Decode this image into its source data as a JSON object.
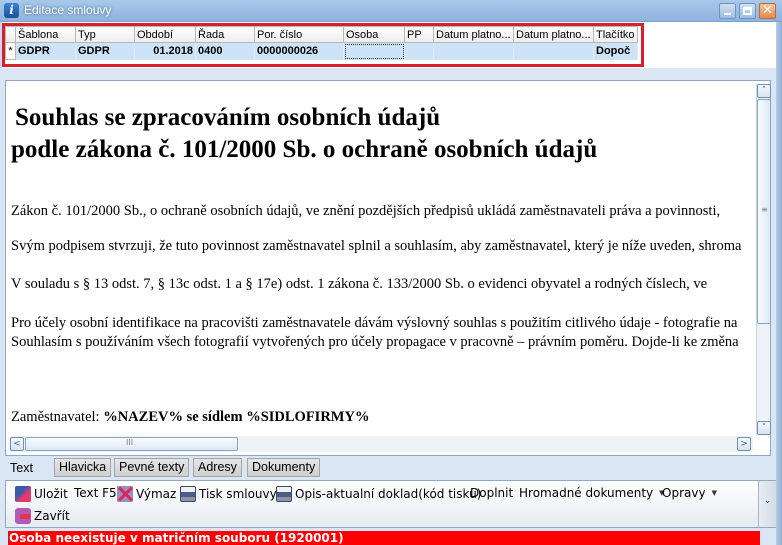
{
  "window": {
    "title": "Editace smlouvy",
    "icon": "info-icon",
    "controls": {
      "minimize": "minimize-icon",
      "maximize": "maximize-icon",
      "close": "close-icon"
    }
  },
  "grid": {
    "columns": [
      "Šablona",
      "Typ",
      "Období",
      "Řada",
      "Por. číslo",
      "Osoba",
      "PP",
      "Datum platno...",
      "Datum platno...",
      "Tlačítko"
    ],
    "row_indicator": "*",
    "rows": [
      [
        "GDPR",
        "GDPR",
        "01.2018",
        "0400",
        "0000000026",
        "",
        "",
        "",
        "",
        "Dopoč"
      ]
    ]
  },
  "document": {
    "heading_line1": "Souhlas se zpracováním osobních údajů",
    "heading_line2": "podle zákona č. 101/2000 Sb. o ochraně osobních údajů",
    "paragraphs": [
      "Zákon č. 101/2000 Sb., o ochraně osobních údajů, ve znění pozdějších předpisů ukládá zaměstnavateli práva a povinnosti,",
      "Svým podpisem stvrzuji, že tuto povinnost zaměstnavatel splnil a souhlasím, aby zaměstnavatel, který je níže uveden, shroma",
      "V souladu s § 13 odst. 7, § 13c odst. 1 a § 17e) odst. 1 zákona č. 133/2000 Sb. o evidenci obyvatel a rodných číslech, ve",
      "Pro účely osobní identifikace na pracovišti zaměstnavatele dávám výslovný souhlas s použitím citlivého údaje - fotografie na",
      "Souhlasím s používáním všech fotografií vytvořených pro účely propagace v pracovně – právním poměru. Dojde-li ke změna"
    ],
    "employer_label": "Zaměstnavatel: ",
    "employer_value": "%NAZEV% se sídlem %SIDLOFIRMY%"
  },
  "tabs": [
    {
      "label": "Text",
      "active": true
    },
    {
      "label": "Hlavicka",
      "active": false
    },
    {
      "label": "Pevné texty",
      "active": false
    },
    {
      "label": "Adresy",
      "active": false
    },
    {
      "label": "Dokumenty",
      "active": false
    }
  ],
  "toolbar": {
    "save": "Uložit",
    "text_f5": "Text F5",
    "delete": "Výmaz",
    "print_contract": "Tisk smlouvy",
    "print_copy": "Opis-aktualní doklad(kód tisku)",
    "fill": "Doplnit",
    "bulk_documents": "Hromadné dokumenty",
    "corrections": "Opravy",
    "close": "Zavřít",
    "dropdown_caret": "▼",
    "overflow": "⌄"
  },
  "status": {
    "message": "Osoba neexistuje v matričním souboru (1920001)",
    "color": "#ff0000"
  },
  "scrollbars": {
    "up": "˄",
    "down": "˅",
    "left": "<",
    "right": ">",
    "vgrip": "≡",
    "hgrip": "III"
  }
}
